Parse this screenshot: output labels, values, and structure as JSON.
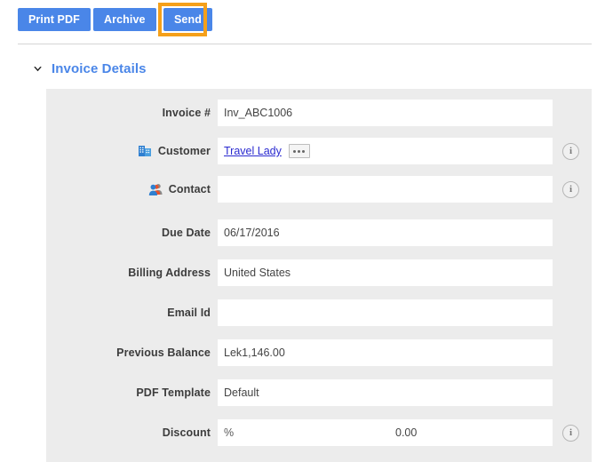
{
  "toolbar": {
    "print_pdf_label": "Print PDF",
    "archive_label": "Archive",
    "send_label": "Send",
    "button_color": "#4a86e8",
    "focus_ring_color": "#f5a01a"
  },
  "section": {
    "title": "Invoice Details",
    "title_color": "#4a86e8",
    "chevron_icon": "chevron-down-icon",
    "expanded": true
  },
  "form": {
    "rows": [
      {
        "label": "Invoice #",
        "value": "Inv_ABC1006",
        "icon": null,
        "info": false,
        "type": "text"
      },
      {
        "label": "Customer",
        "value": "Travel Lady",
        "icon": "company-building-icon",
        "info": true,
        "type": "link",
        "picker_label": "..."
      },
      {
        "label": "Contact",
        "value": "",
        "icon": "contacts-people-icon",
        "info": true,
        "type": "text"
      },
      {
        "label": "Due Date",
        "value": "06/17/2016",
        "icon": null,
        "info": false,
        "type": "text"
      },
      {
        "label": "Billing Address",
        "value": "United States",
        "icon": null,
        "info": false,
        "type": "text"
      },
      {
        "label": "Email Id",
        "value": "",
        "icon": null,
        "info": false,
        "type": "text"
      },
      {
        "label": "Previous Balance",
        "value": "Lek1,146.00",
        "icon": null,
        "info": false,
        "type": "text"
      },
      {
        "label": "PDF Template",
        "value": "Default",
        "icon": null,
        "info": false,
        "type": "text"
      },
      {
        "label": "Discount",
        "value": "0.00",
        "unit": "%",
        "icon": null,
        "info": true,
        "type": "discount"
      }
    ]
  }
}
